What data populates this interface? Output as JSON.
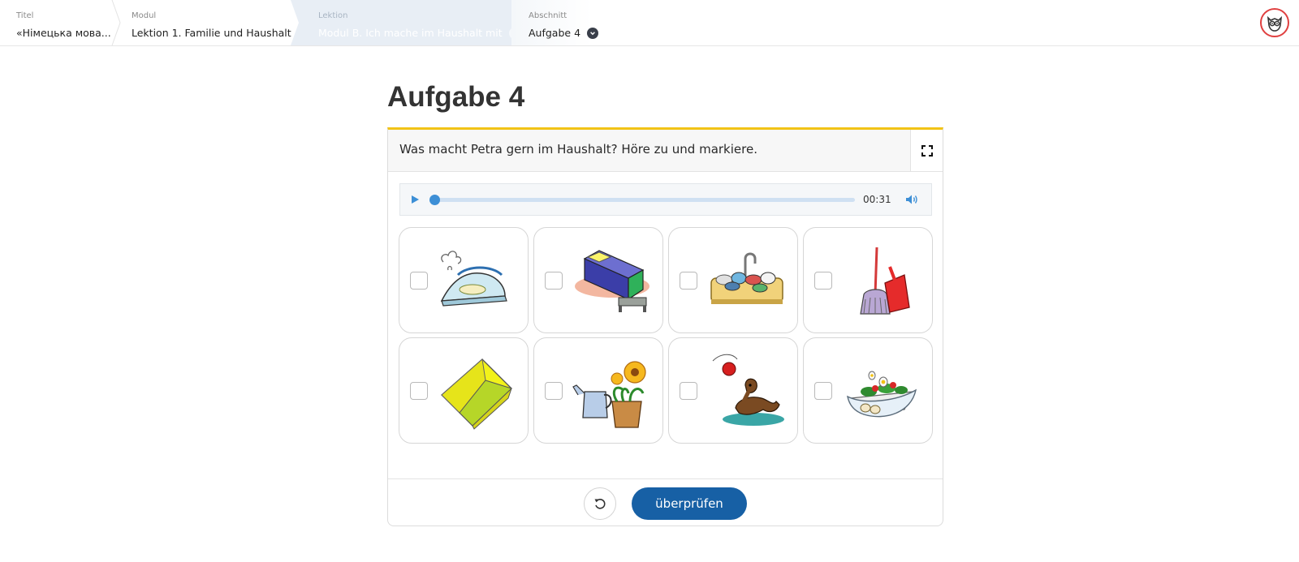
{
  "breadcrumb": {
    "title": {
      "label": "Titel",
      "value": "«Німецька мова..."
    },
    "modul": {
      "label": "Modul",
      "value": "Lektion 1. Familie und Haushalt"
    },
    "lektion": {
      "label": "Lektion",
      "value": "Modul B. Ich mache im Haushalt mit"
    },
    "abschnitt": {
      "label": "Abschnitt",
      "value": "Aufgabe 4"
    }
  },
  "page": {
    "title": "Aufgabe 4"
  },
  "task": {
    "instruction": "Was macht Petra gern im Haushalt? Höre zu und markiere.",
    "audio": {
      "time": "00:31",
      "progress": 0.0
    },
    "options": [
      {
        "icon": "iron-icon",
        "checked": false
      },
      {
        "icon": "bed-icon",
        "checked": false
      },
      {
        "icon": "dishes-in-sink-icon",
        "checked": false
      },
      {
        "icon": "broom-dustpan-icon",
        "checked": false
      },
      {
        "icon": "folded-cloth-icon",
        "checked": false
      },
      {
        "icon": "watering-can-flowers-icon",
        "checked": false
      },
      {
        "icon": "dog-playing-ball-icon",
        "checked": false
      },
      {
        "icon": "salad-bowl-icon",
        "checked": false
      }
    ]
  },
  "actions": {
    "check_label": "überprüfen"
  },
  "colors": {
    "accent": "#1760a5",
    "top_border": "#f2c316",
    "audio_accent": "#3d8fd6"
  }
}
